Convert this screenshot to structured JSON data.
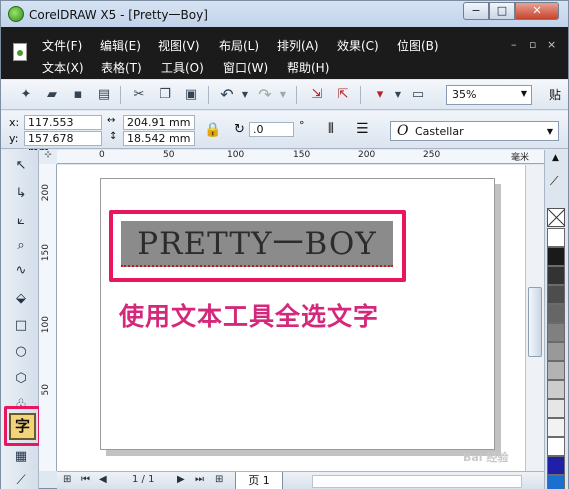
{
  "window": {
    "title": "CorelDRAW X5 - [Pretty一Boy]",
    "controls": {
      "minimize": "−",
      "maximize": "□",
      "close": "✕"
    }
  },
  "menubar": {
    "row1": [
      "文件(F)",
      "编辑(E)",
      "视图(V)",
      "布局(L)",
      "排列(A)",
      "效果(C)",
      "位图(B)"
    ],
    "row2": [
      "文本(X)",
      "表格(T)",
      "工具(O)",
      "窗口(W)",
      "帮助(H)"
    ],
    "mdi_controls": {
      "minimize": "–",
      "restore": "▫",
      "close": "×"
    }
  },
  "toolbar": {
    "icons": [
      "new-icon",
      "open-icon",
      "save-icon",
      "print-icon",
      "cut-icon",
      "copy-icon",
      "paste-icon",
      "undo-icon",
      "redo-icon",
      "import-icon",
      "export-icon",
      "publish-pdf-icon",
      "application-launcher-icon"
    ],
    "zoom": "35%",
    "trailing_label": "贴"
  },
  "propbar": {
    "x_label": "x:",
    "x_value": "117.553 mm",
    "y_label": "y:",
    "y_value": "157.678 mm",
    "w_value": "204.91 mm",
    "h_value": "18.542 mm",
    "rotation": ".0",
    "rotation_unit": "°",
    "font": "Castellar"
  },
  "toolbox": {
    "tools": [
      "pick-tool-icon",
      "shape-tool-icon",
      "crop-tool-icon",
      "zoom-tool-icon",
      "freehand-tool-icon",
      "smart-fill-tool-icon",
      "rectangle-tool-icon",
      "ellipse-tool-icon",
      "polygon-tool-icon",
      "basic-shapes-tool-icon",
      "text-tool-icon",
      "table-tool-icon",
      "dimension-tool-icon"
    ],
    "text_tool_glyph": "字"
  },
  "rulers": {
    "top_ticks": [
      "0",
      "50",
      "100",
      "150",
      "200",
      "250"
    ],
    "left_ticks": [
      "200",
      "150",
      "100",
      "50"
    ],
    "unit_label": "毫米"
  },
  "canvas": {
    "artistic_text": "PRETTY一BOY",
    "annotation_caption": "使用文本工具全选文字"
  },
  "palette": {
    "swatches": [
      "#ffffff",
      "#1a1a1a",
      "#333333",
      "#4d4d4d",
      "#666666",
      "#808080",
      "#999999",
      "#b3b3b3",
      "#cccccc",
      "#e6e6e6",
      "#f2f2f2",
      "#ffffff",
      "#1f1fa8",
      "#1a6fd0",
      "#2aa8e0"
    ]
  },
  "statusbar": {
    "page_count": "1 / 1",
    "page_tab": "页 1"
  },
  "watermark": "Bai 经验"
}
